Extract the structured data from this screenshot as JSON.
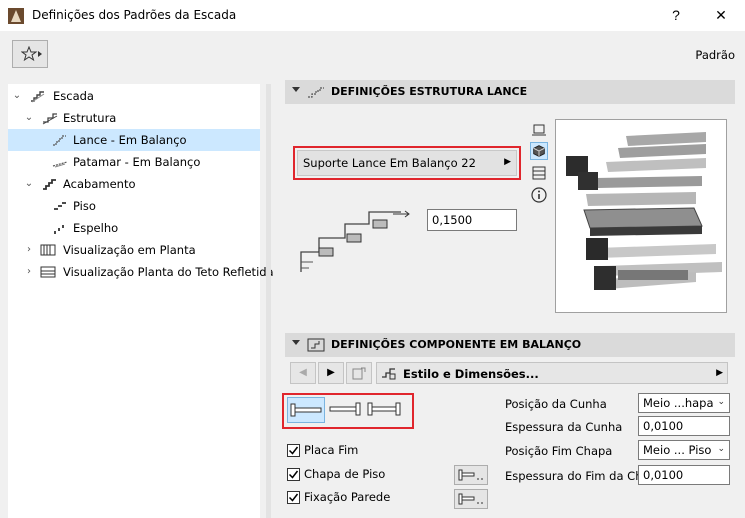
{
  "window": {
    "title": "Definições dos Padrões da Escada",
    "help_label": "?",
    "close_label": "✕"
  },
  "toolbar": {
    "favorites_icon": "star-arrow-icon",
    "preset_label": "Padrão"
  },
  "tree": {
    "items": [
      {
        "label": "Escada",
        "expanded": true,
        "icon": "stair-icon"
      },
      {
        "label": "Estrutura",
        "expanded": true,
        "icon": "structure-icon"
      },
      {
        "label": "Lance - Em Balanço",
        "selected": true,
        "icon": "flight-icon"
      },
      {
        "label": "Patamar - Em Balanço",
        "icon": "landing-icon"
      },
      {
        "label": "Acabamento",
        "expanded": true,
        "icon": "finish-icon"
      },
      {
        "label": "Piso",
        "icon": "tread-icon"
      },
      {
        "label": "Espelho",
        "icon": "riser-icon"
      },
      {
        "label": "Visualização em Planta",
        "expanded": false,
        "icon": "plan-view-icon"
      },
      {
        "label": "Visualização Planta do Teto Refletida",
        "expanded": false,
        "icon": "ceiling-plan-icon"
      }
    ]
  },
  "section1": {
    "title": "DEFINIÇÕES ESTRUTURA LANCE",
    "profile_button": "Suporte Lance Em Balanço 22",
    "thickness_value": "0,1500"
  },
  "section2": {
    "title": "DEFINIÇÕES COMPONENTE EM BALANÇO",
    "style_label": "Estilo e Dimensões...",
    "checkboxes": [
      {
        "label": "Placa Fim",
        "checked": true
      },
      {
        "label": "Chapa de Piso",
        "checked": true
      },
      {
        "label": "Fixação Parede",
        "checked": true
      }
    ],
    "fields": [
      {
        "label": "Posição da Cunha",
        "value": "Meio ...hapa",
        "type": "select"
      },
      {
        "label": "Espessura da Cunha",
        "value": "0,0100",
        "type": "input"
      },
      {
        "label": "Posição Fim Chapa",
        "value": "Meio ... Piso",
        "type": "select"
      },
      {
        "label": "Espessura do Fim da Ch...",
        "value": "0,0100",
        "type": "input"
      }
    ]
  },
  "colors": {
    "highlight_red": "#e0262d",
    "selected_row": "#cce8ff",
    "section_header": "#dadada"
  }
}
